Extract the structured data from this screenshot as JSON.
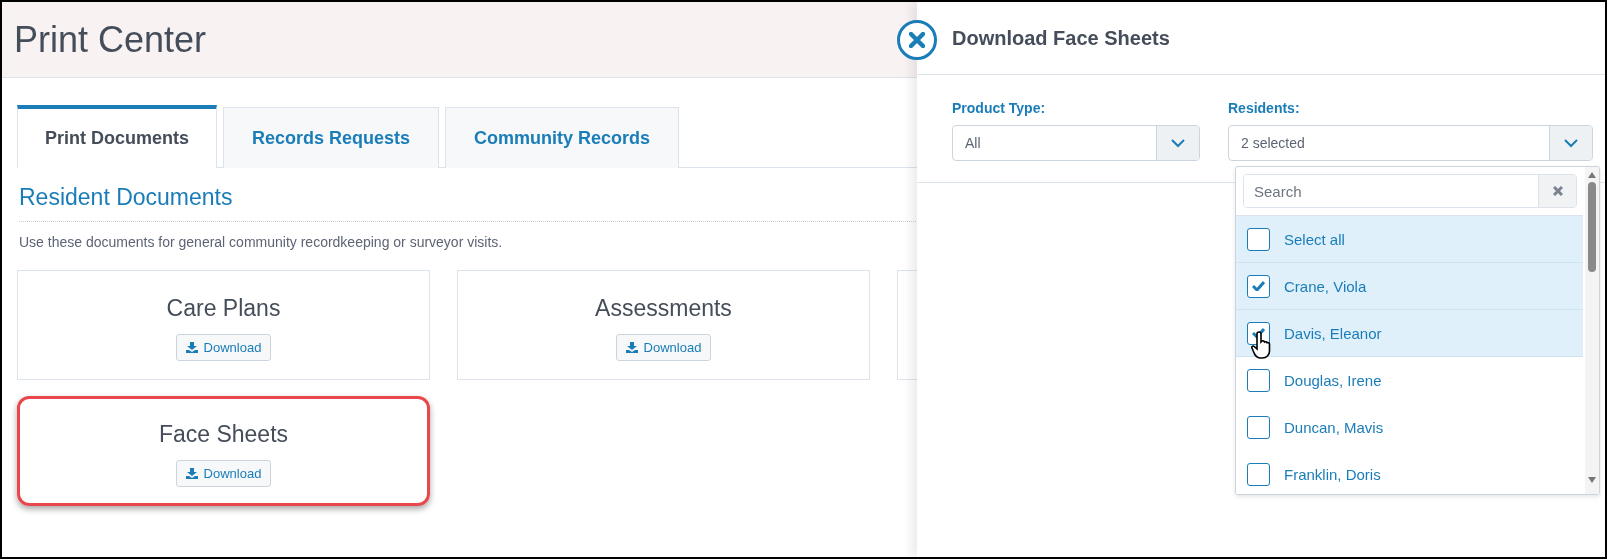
{
  "page": {
    "title": "Print Center"
  },
  "tabs": [
    {
      "label": "Print Documents",
      "selected": true
    },
    {
      "label": "Records Requests",
      "selected": false
    },
    {
      "label": "Community Records",
      "selected": false
    }
  ],
  "section": {
    "heading": "Resident Documents",
    "description": "Use these documents for general community recordkeeping or surveyor visits."
  },
  "cards": [
    {
      "title": "Care Plans",
      "button": "Download",
      "highlighted": false
    },
    {
      "title": "Assessments",
      "button": "Download",
      "highlighted": false
    },
    {
      "title": "Face Sheets",
      "button": "Download",
      "highlighted": true
    }
  ],
  "panel": {
    "title": "Download Face Sheets",
    "product_type": {
      "label": "Product Type:",
      "value": "All"
    },
    "residents": {
      "label": "Residents:",
      "value": "2 selected",
      "expanded": true,
      "search": {
        "placeholder": "Search"
      },
      "options": [
        {
          "label": "Select all",
          "checked": false,
          "highlighted": true
        },
        {
          "label": "Crane, Viola",
          "checked": true,
          "highlighted": true
        },
        {
          "label": "Davis, Eleanor",
          "checked": true,
          "highlighted": true
        },
        {
          "label": "Douglas, Irene",
          "checked": false,
          "highlighted": false
        },
        {
          "label": "Duncan, Mavis",
          "checked": false,
          "highlighted": false
        },
        {
          "label": "Franklin, Doris",
          "checked": false,
          "highlighted": false
        }
      ]
    }
  }
}
